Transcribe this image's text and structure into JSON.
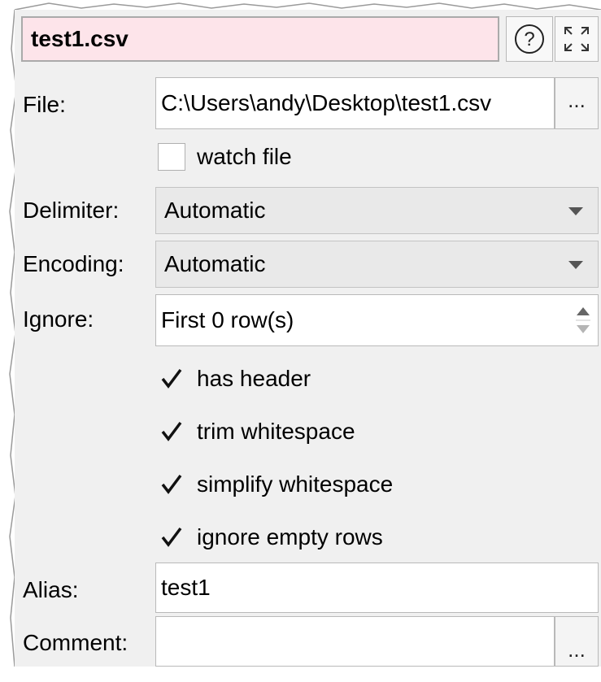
{
  "title": "test1.csv",
  "file": {
    "label": "File:",
    "value": "C:\\Users\\andy\\Desktop\\test1.csv",
    "browse": "..."
  },
  "watch": {
    "label": "watch file",
    "checked": false
  },
  "delimiter": {
    "label": "Delimiter:",
    "value": "Automatic"
  },
  "encoding": {
    "label": "Encoding:",
    "value": "Automatic"
  },
  "ignore": {
    "label": "Ignore:",
    "value": "First 0 row(s)"
  },
  "options": [
    {
      "label": "has header",
      "checked": true
    },
    {
      "label": "trim whitespace",
      "checked": true
    },
    {
      "label": "simplify whitespace",
      "checked": true
    },
    {
      "label": "ignore empty rows",
      "checked": true
    }
  ],
  "alias": {
    "label": "Alias:",
    "value": "test1"
  },
  "comment": {
    "label": "Comment:",
    "value": "",
    "browse": "..."
  },
  "colors": {
    "title_bg": "#fde4ea",
    "panel_bg": "#f0f0f0"
  }
}
